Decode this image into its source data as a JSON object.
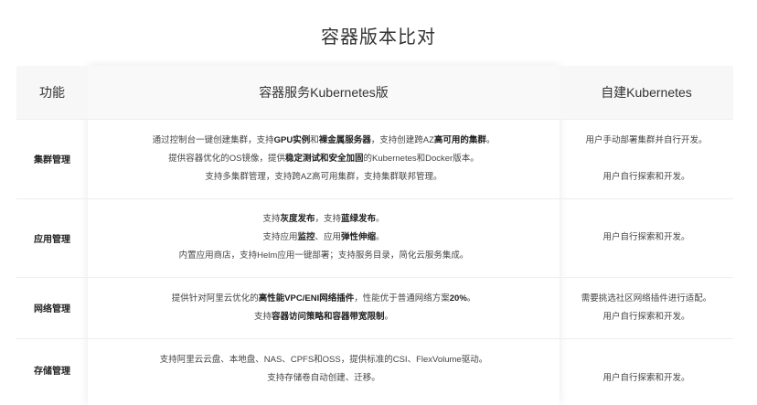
{
  "page": {
    "title": "容器版本比对"
  },
  "table": {
    "headers": {
      "function": "功能",
      "managed": "容器服务Kubernetes版",
      "self_built": "自建Kubernetes"
    },
    "rows": [
      {
        "label": "集群管理",
        "managed_lines": [
          [
            {
              "t": "通过控制台一键创建集群，支持"
            },
            {
              "t": "GPU实例",
              "b": true
            },
            {
              "t": "和"
            },
            {
              "t": "裸金属服务器",
              "b": true
            },
            {
              "t": "，支持创建跨AZ"
            },
            {
              "t": "高可用的集群",
              "b": true
            },
            {
              "t": "。"
            }
          ],
          [
            {
              "t": "提供容器优化的OS镜像，提供"
            },
            {
              "t": "稳定测试和安全加固",
              "b": true
            },
            {
              "t": "的Kubernetes和Docker版本。"
            }
          ],
          [
            {
              "t": "支持多集群管理，支持跨AZ高可用集群，支持集群联邦管理。"
            }
          ]
        ],
        "self_lines": [
          "用户手动部署集群并自行开发。",
          "",
          "用户自行探索和开发。"
        ]
      },
      {
        "label": "应用管理",
        "managed_lines": [
          [
            {
              "t": "支持"
            },
            {
              "t": "灰度发布",
              "b": true
            },
            {
              "t": "，支持"
            },
            {
              "t": "蓝绿发布",
              "b": true
            },
            {
              "t": "。"
            }
          ],
          [
            {
              "t": "支持应用"
            },
            {
              "t": "监控",
              "b": true
            },
            {
              "t": "、应用"
            },
            {
              "t": "弹性伸缩",
              "b": true
            },
            {
              "t": "。"
            }
          ],
          [
            {
              "t": "内置应用商店，支持Helm应用一键部署；支持服务目录，简化云服务集成。"
            }
          ]
        ],
        "self_lines": [
          "用户自行探索和开发。"
        ]
      },
      {
        "label": "网络管理",
        "managed_lines": [
          [
            {
              "t": "提供针对阿里云优化的"
            },
            {
              "t": "高性能VPC/ENI网络插件",
              "b": true
            },
            {
              "t": "，性能优于普通网络方案"
            },
            {
              "t": "20%",
              "b": true
            },
            {
              "t": "。"
            }
          ],
          [
            {
              "t": "支持"
            },
            {
              "t": "容器访问策略和容器带宽限制",
              "b": true
            },
            {
              "t": "。"
            }
          ]
        ],
        "self_lines": [
          "需要挑选社区网络插件进行适配。",
          "用户自行探索和开发。"
        ]
      },
      {
        "label": "存储管理",
        "managed_lines": [
          [
            {
              "t": "支持阿里云云盘、本地盘、NAS、CPFS和OSS，提供标准的CSI、FlexVolume驱动。"
            }
          ],
          [
            {
              "t": "支持存储卷自动创建、迁移。"
            }
          ]
        ],
        "self_lines": [
          "",
          "用户自行探索和开发。"
        ]
      }
    ]
  }
}
